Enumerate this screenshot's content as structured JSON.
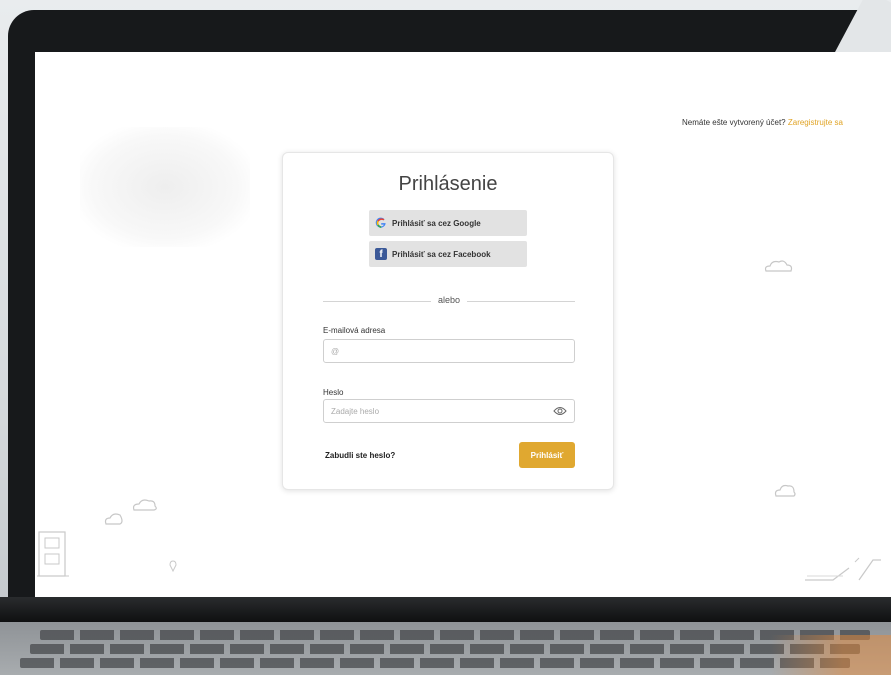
{
  "header": {
    "signup_prompt": "Nemáte ešte vytvorený účet?",
    "signup_link": "Zaregistrujte sa"
  },
  "login_card": {
    "title": "Prihlásenie",
    "google_label": "Prihlásiť sa cez Google",
    "facebook_label": "Prihlásiť sa cez Facebook",
    "divider_text": "alebo",
    "email_label": "E-mailová adresa",
    "email_placeholder": "@",
    "password_label": "Heslo",
    "password_placeholder": "Zadajte heslo",
    "forgot_label": "Zabudli ste heslo?",
    "submit_label": "Prihlásiť"
  },
  "colors": {
    "accent": "#e0a830",
    "link": "#e0a324",
    "facebook": "#3b5998",
    "social_button_bg": "#e2e2e2"
  },
  "icons": {
    "google": "google-g-icon",
    "facebook": "facebook-f-icon",
    "password_toggle": "eye-icon"
  }
}
